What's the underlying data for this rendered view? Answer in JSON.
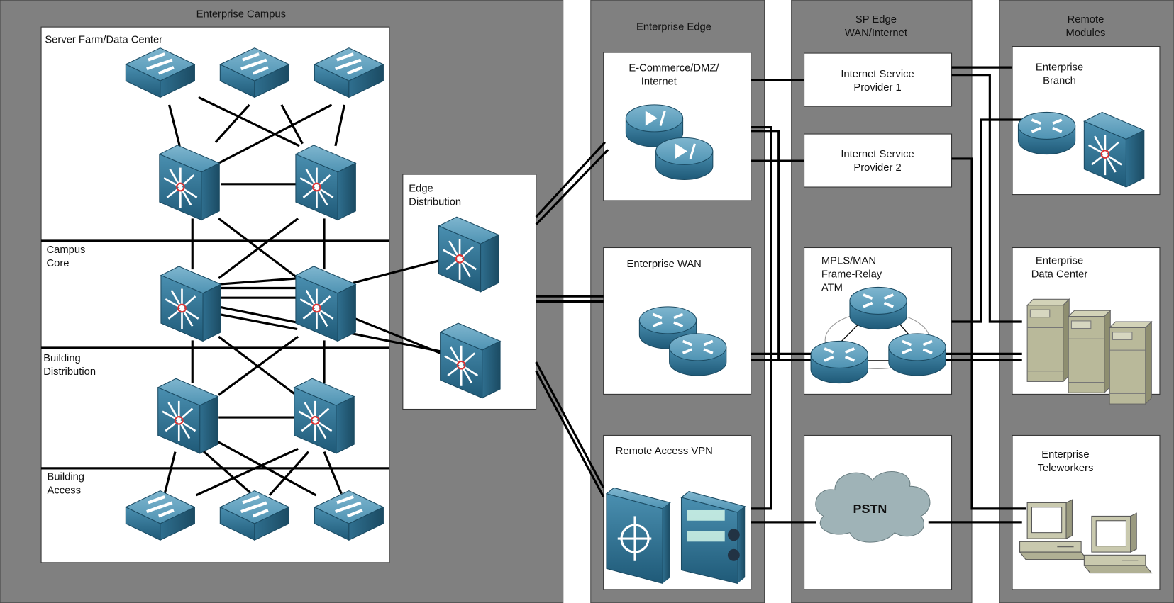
{
  "modules": {
    "campus": {
      "title": "Enterprise Campus",
      "server_farm": "Server Farm/Data Center",
      "core_1": "Campus",
      "core_2": "Core",
      "dist_1": "Building",
      "dist_2": "Distribution",
      "access_1": "Building",
      "access_2": "Access",
      "edge_dist_1": "Edge",
      "edge_dist_2": "Distribution"
    },
    "edge": {
      "title": "Enterprise Edge",
      "ecommerce_1": "E-Commerce/DMZ/",
      "ecommerce_2": "Internet",
      "wan": "Enterprise WAN",
      "vpn": "Remote Access VPN"
    },
    "sp": {
      "title_1": "SP Edge",
      "title_2": "WAN/Internet",
      "isp1_1": "Internet Service",
      "isp1_2": "Provider 1",
      "isp2_1": "Internet Service",
      "isp2_2": "Provider 2",
      "mpls_1": "MPLS/MAN",
      "mpls_2": "Frame-Relay",
      "mpls_3": "ATM",
      "pstn": "PSTN"
    },
    "remote": {
      "title_1": "Remote",
      "title_2": "Modules",
      "branch_1": "Enterprise",
      "branch_2": "Branch",
      "dc_1": "Enterprise",
      "dc_2": "Data Center",
      "tele_1": "Enterprise",
      "tele_2": "Teleworkers"
    }
  },
  "colors": {
    "panel": "#808080",
    "device": "#3d85a6",
    "server": "#b9b99a"
  }
}
